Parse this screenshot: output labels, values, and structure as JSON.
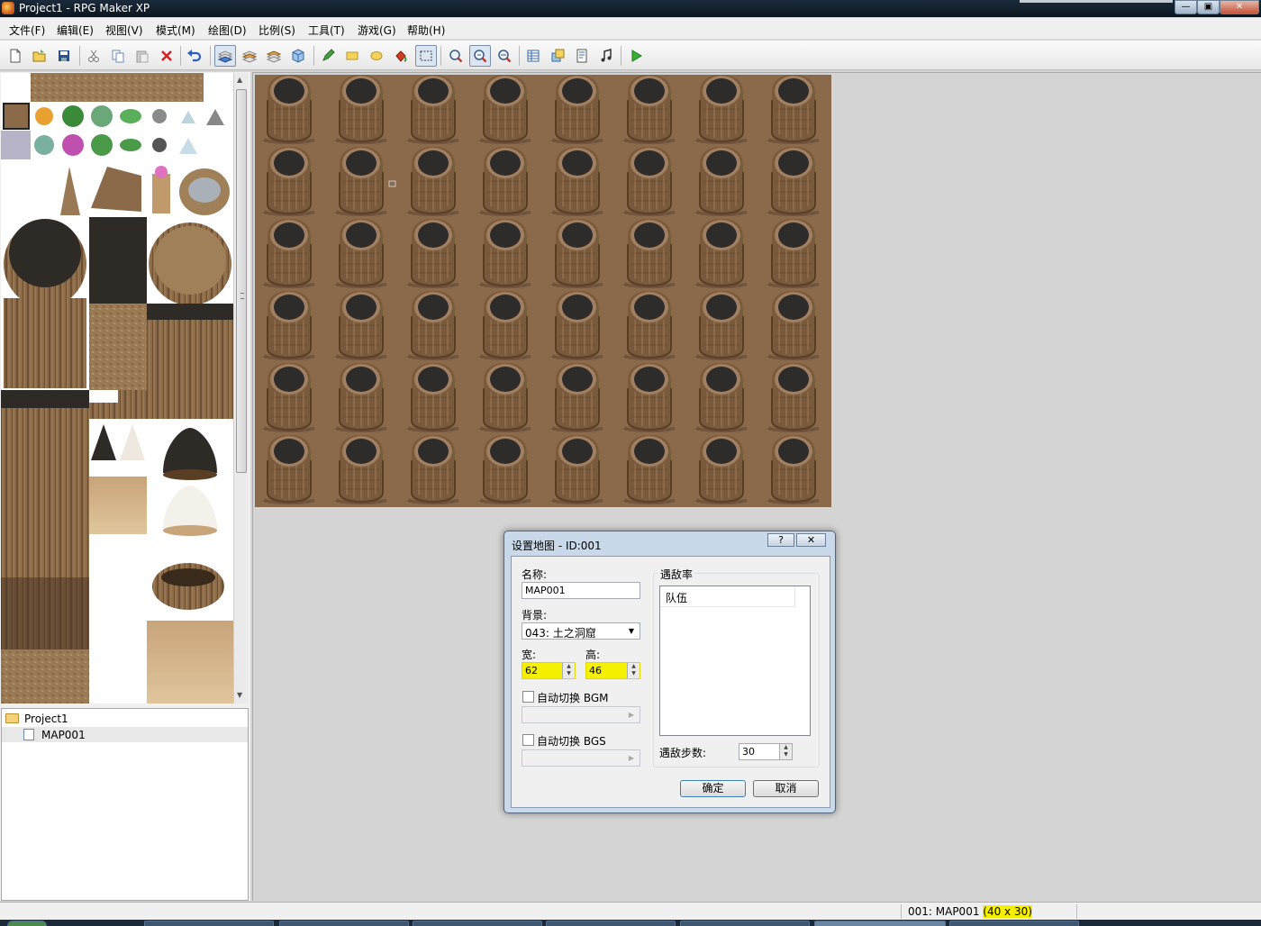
{
  "window": {
    "title": "Project1 - RPG Maker XP",
    "controls": [
      "—",
      "▣",
      "✕"
    ]
  },
  "menu": [
    "文件(F)",
    "编辑(E)",
    "视图(V)",
    "模式(M)",
    "绘图(D)",
    "比例(S)",
    "工具(T)",
    "游戏(G)",
    "帮助(H)"
  ],
  "toolbar": {
    "buttons": [
      {
        "name": "new-project",
        "icon": "new-file-icon"
      },
      {
        "name": "open-project",
        "icon": "open-folder-icon"
      },
      {
        "name": "save-project",
        "icon": "save-disk-icon"
      },
      {
        "name": "cut",
        "icon": "scissors-icon"
      },
      {
        "name": "copy",
        "icon": "copy-icon"
      },
      {
        "name": "paste",
        "icon": "paste-icon"
      },
      {
        "name": "delete",
        "icon": "red-x-icon"
      },
      {
        "name": "undo",
        "icon": "undo-arrow-icon"
      },
      {
        "name": "layer-1",
        "icon": "layer-1-icon",
        "pressed": true
      },
      {
        "name": "layer-2",
        "icon": "layer-2-icon"
      },
      {
        "name": "layer-3",
        "icon": "layer-3-icon"
      },
      {
        "name": "event-layer",
        "icon": "event-cube-icon"
      },
      {
        "name": "pencil",
        "icon": "pencil-icon"
      },
      {
        "name": "rectangle",
        "icon": "rectangle-icon"
      },
      {
        "name": "ellipse",
        "icon": "ellipse-icon"
      },
      {
        "name": "fill",
        "icon": "fill-bucket-icon"
      },
      {
        "name": "select",
        "icon": "select-dotted-icon",
        "pressed": true
      },
      {
        "name": "zoom-1-1",
        "icon": "zoom-1-1-icon"
      },
      {
        "name": "zoom-1-2",
        "icon": "zoom-1-2-icon",
        "pressed": true
      },
      {
        "name": "zoom-1-4",
        "icon": "zoom-1-4-icon"
      },
      {
        "name": "database",
        "icon": "database-icon"
      },
      {
        "name": "materials",
        "icon": "materials-icon"
      },
      {
        "name": "script-editor",
        "icon": "script-editor-icon"
      },
      {
        "name": "sound-test",
        "icon": "music-note-icon"
      },
      {
        "name": "playtest",
        "icon": "play-triangle-icon"
      }
    ]
  },
  "tree": {
    "project": "Project1",
    "maps": [
      "MAP001"
    ]
  },
  "dialog": {
    "title": "设置地图 - ID:001",
    "help_btn": "?",
    "close_btn": "✕",
    "name_label": "名称:",
    "name_value": "MAP001",
    "bg_label": "背景:",
    "bg_value": "043: 土之洞窟",
    "width_label": "宽:",
    "width_value": "62",
    "height_label": "高:",
    "height_value": "46",
    "bgm_label": "自动切换 BGM",
    "bgs_label": "自动切换 BGS",
    "encounter_label": "遇敌率",
    "party_header": "队伍",
    "steps_label": "遇敌步数:",
    "steps_value": "30",
    "ok": "确定",
    "cancel": "取消"
  },
  "status": {
    "map": "001: MAP001 ",
    "size": "(40 x 30)"
  },
  "colors": {
    "highlight": "#f5f000",
    "map_ground": "#8a6a4a",
    "titlebar": "#0c1620"
  }
}
